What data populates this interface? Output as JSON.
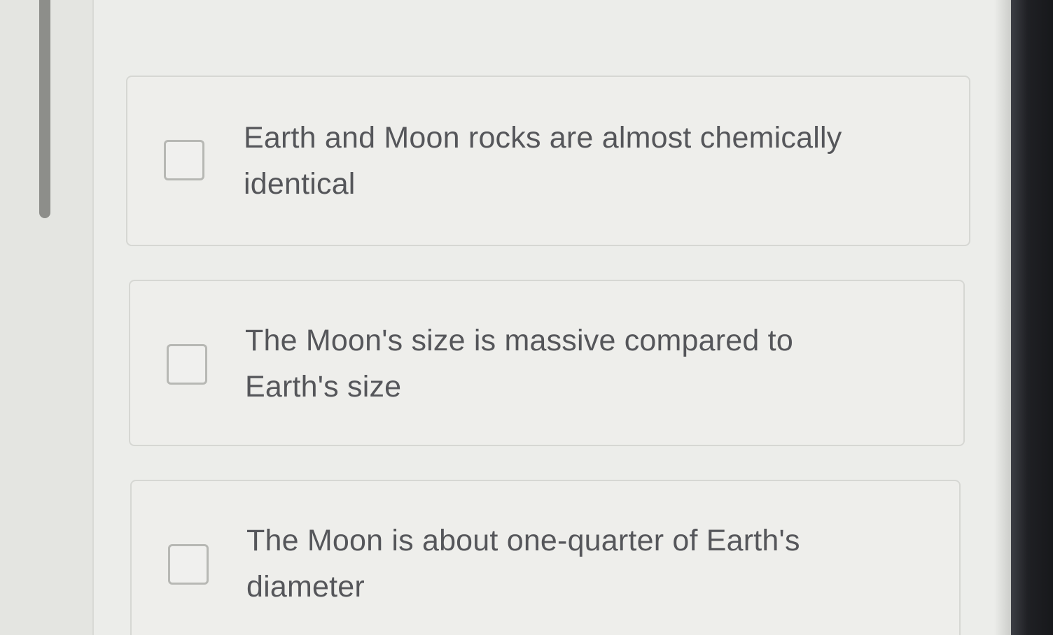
{
  "question": {
    "options": [
      {
        "line1": "Earth and Moon rocks are almost chemically",
        "line2": "identical",
        "checked": false
      },
      {
        "line1": "The Moon's size is massive compared to",
        "line2": "Earth's size",
        "checked": false
      },
      {
        "line1": "The Moon is about one-quarter of Earth's",
        "line2": "diameter",
        "checked": false
      }
    ]
  }
}
